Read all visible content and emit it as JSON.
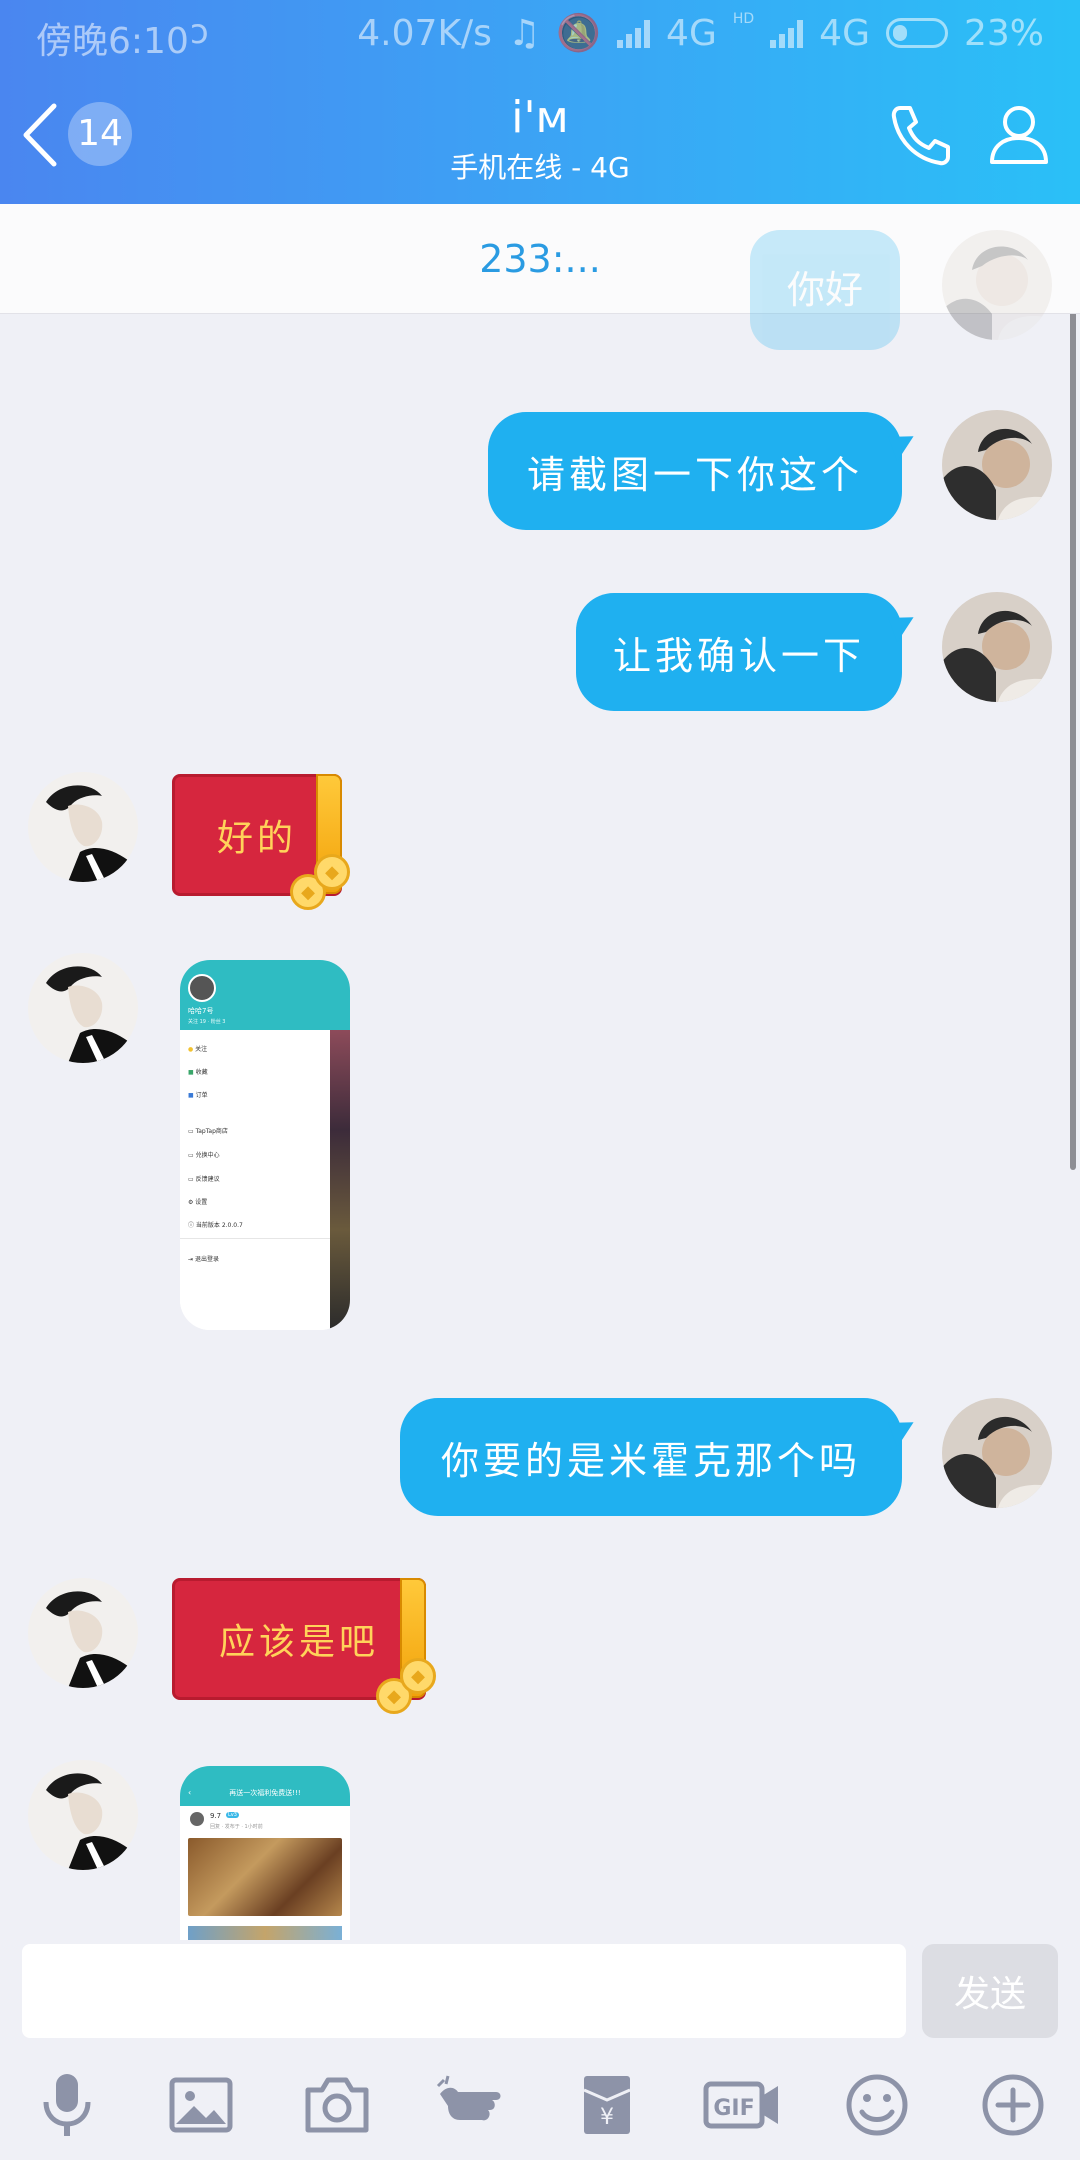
{
  "status_bar": {
    "time": "傍晚6:10",
    "network_speed": "4.07K/s",
    "net1": "4G",
    "net2": "4G",
    "hd": "HD",
    "battery": "23%"
  },
  "header": {
    "unread_count": "14",
    "contact_name": "i'м",
    "contact_status": "手机在线 - 4G"
  },
  "banner_text": "233:...",
  "faded_message": "你好",
  "messages": [
    {
      "side": "right",
      "type": "text",
      "text": "请截图一下你这个"
    },
    {
      "side": "right",
      "type": "text",
      "text": "让我确认一下"
    },
    {
      "side": "left",
      "type": "redpacket",
      "text": "好的"
    },
    {
      "side": "left",
      "type": "image"
    },
    {
      "side": "right",
      "type": "text",
      "text": "你要的是米霍克那个吗"
    },
    {
      "side": "left",
      "type": "redpacket",
      "text": "应该是吧"
    },
    {
      "side": "left",
      "type": "image"
    }
  ],
  "screenshot1": {
    "user": "哈哈7号",
    "sub": "关注 19 · 粉丝 3",
    "menu": [
      "关注",
      "收藏",
      "订单",
      "TapTap商店",
      "兑换中心",
      "反馈建议",
      "设置",
      "当前版本 2.0.0.7",
      "退出登录"
    ]
  },
  "screenshot2": {
    "title": "再送一次福利免费送!!!",
    "user": "9.7",
    "tag": "Lv3",
    "meta": "回复 · 发布于 · 1小时前"
  },
  "input": {
    "placeholder": "",
    "send_label": "发送"
  },
  "toolbar": [
    "microphone-icon",
    "image-icon",
    "camera-icon",
    "poke-icon",
    "red-packet-icon",
    "gif-icon",
    "emoji-icon",
    "plus-icon"
  ],
  "colors": {
    "bubble": "#1fb0f0",
    "header_start": "#4a86f0",
    "header_end": "#2ac0f7",
    "background": "#eff0f6",
    "red_packet": "#d6263e"
  }
}
